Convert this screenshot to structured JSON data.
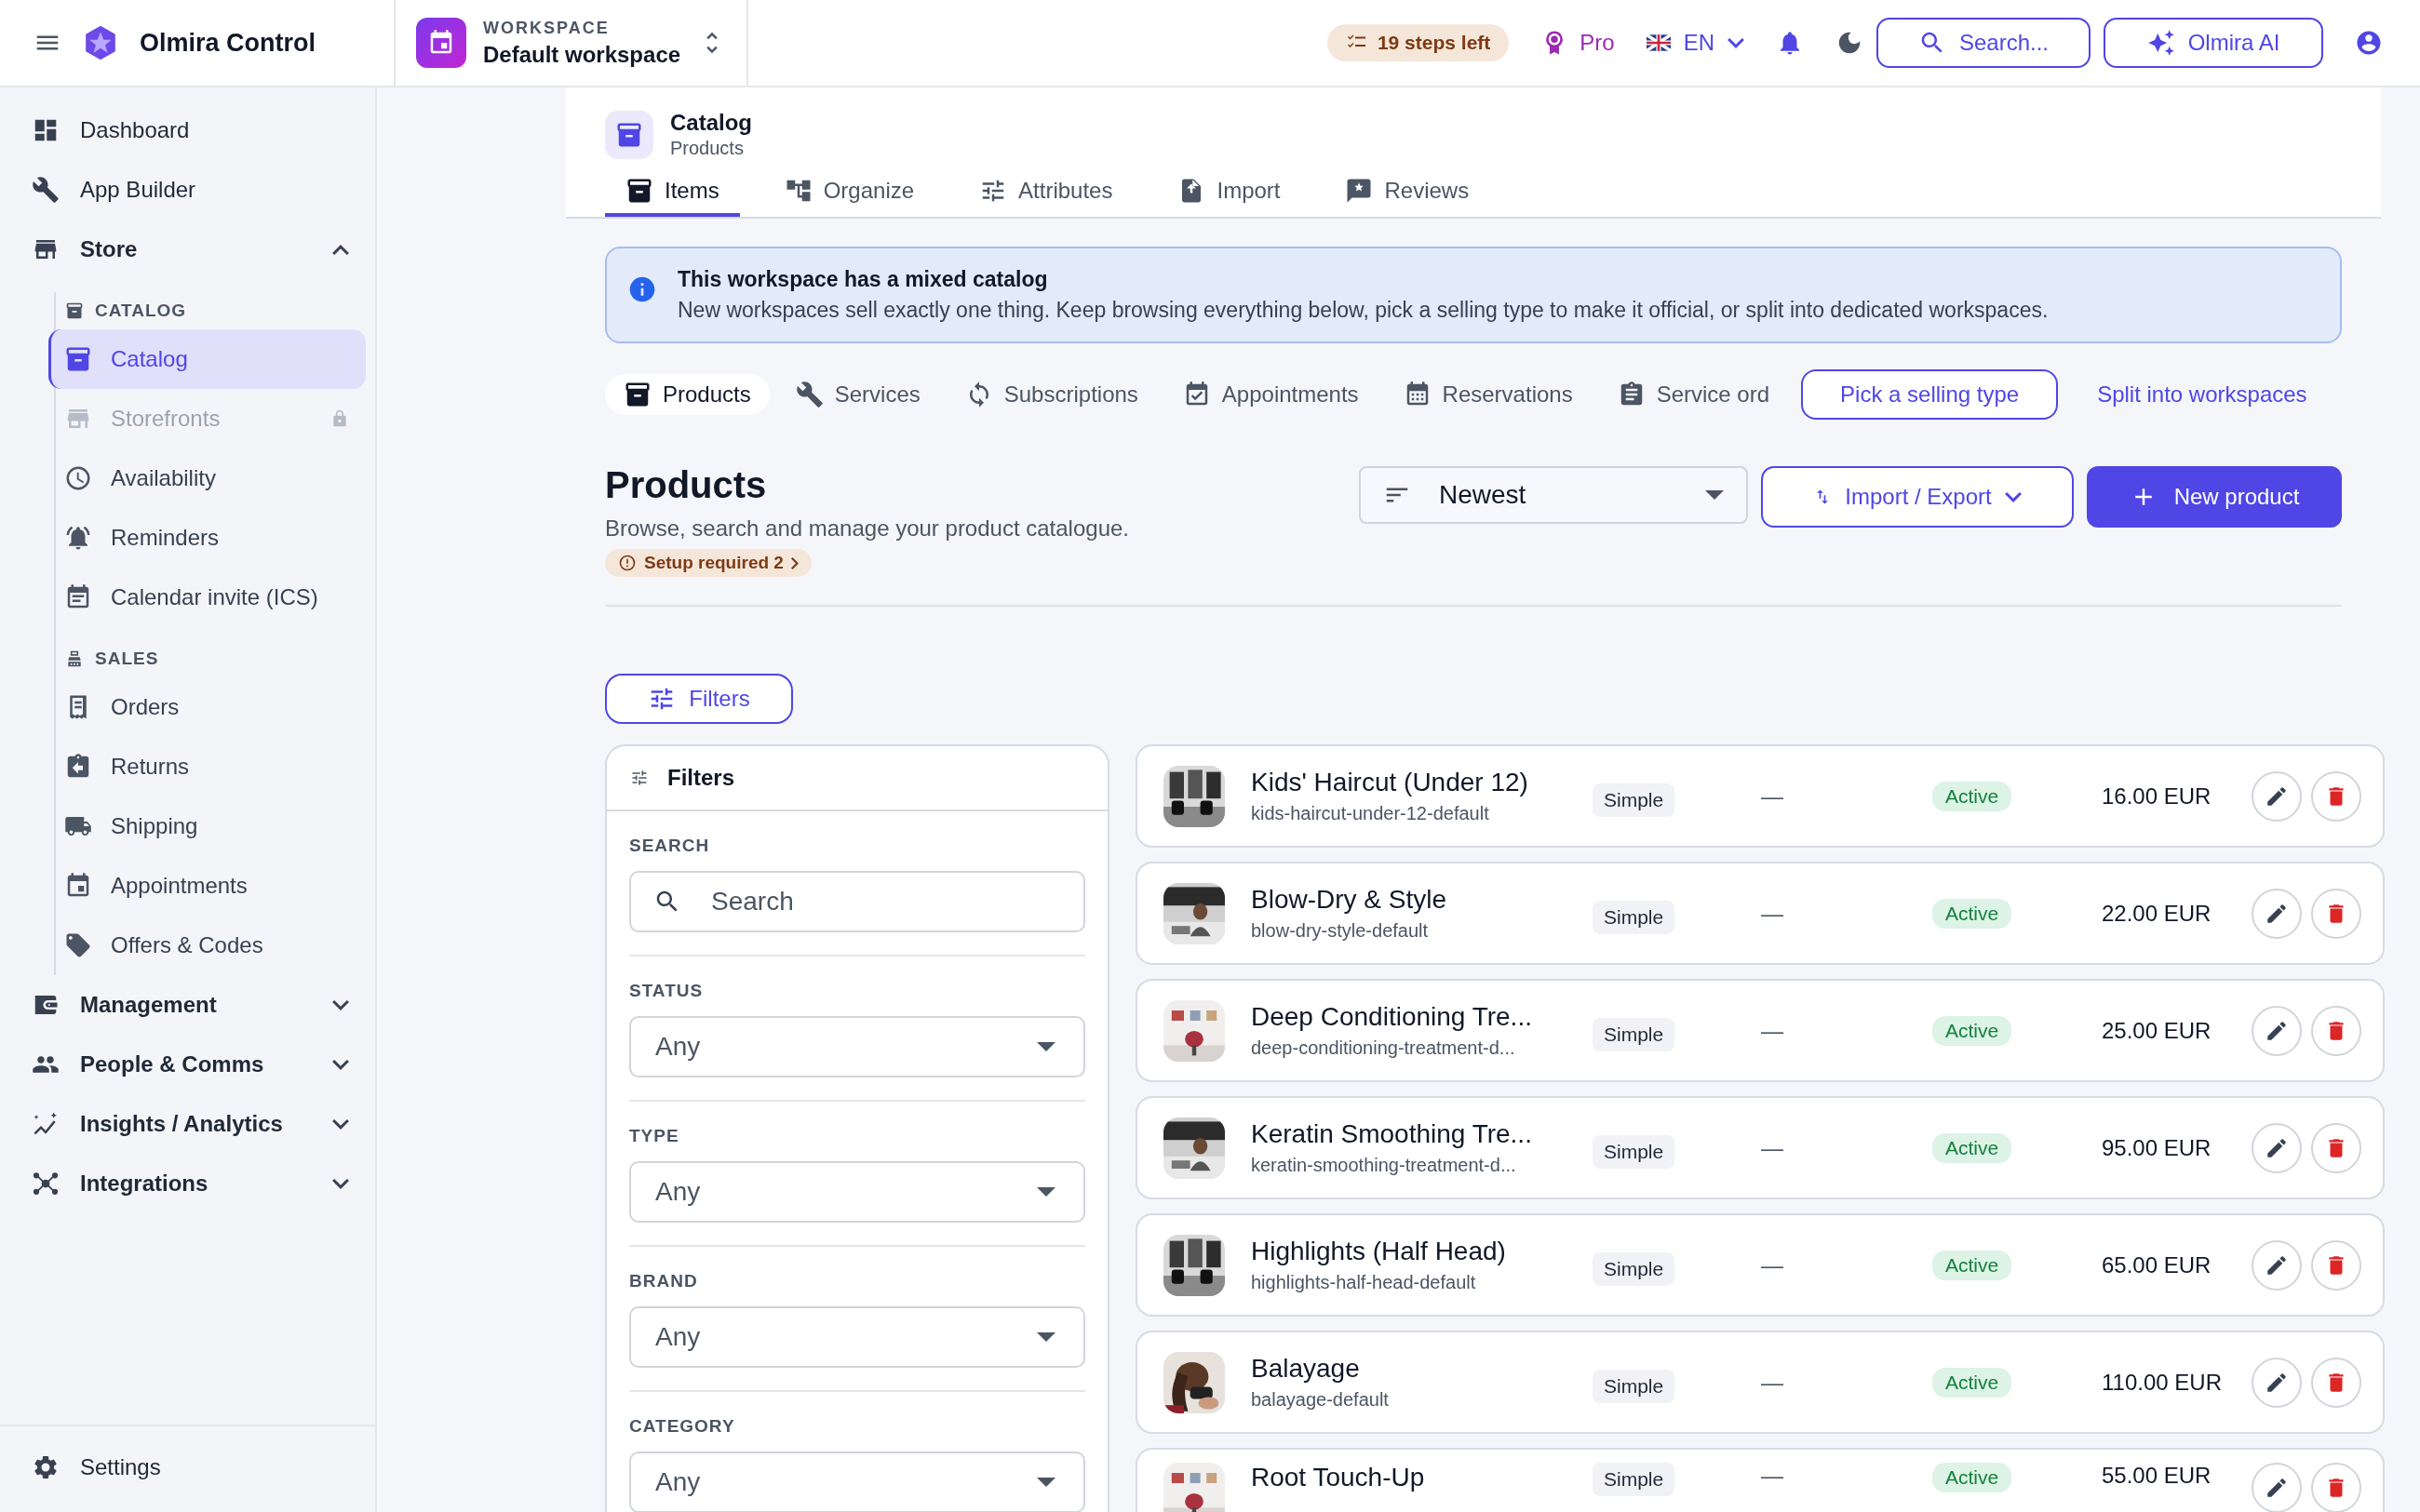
{
  "topbar": {
    "app_name": "Olmira Control",
    "workspace_label": "WORKSPACE",
    "workspace_name": "Default workspace",
    "steps": "19 steps left",
    "plan": "Pro",
    "language": "EN",
    "search": "Search...",
    "ai_button": "Olmira AI"
  },
  "sidebar": {
    "items": [
      {
        "kind": "link",
        "label": "Dashboard",
        "selected": false
      },
      {
        "kind": "link",
        "label": "App Builder",
        "selected": false
      },
      {
        "kind": "section",
        "label": "Store",
        "expanded": true,
        "children": [
          {
            "kind": "group",
            "label": "CATALOG",
            "children": [
              {
                "label": "Catalog",
                "selected": true,
                "disabled": false,
                "locked": false
              },
              {
                "label": "Storefronts",
                "selected": false,
                "disabled": true,
                "locked": true
              },
              {
                "label": "Availability",
                "selected": false,
                "disabled": false,
                "locked": false
              },
              {
                "label": "Reminders",
                "selected": false,
                "disabled": false,
                "locked": false
              },
              {
                "label": "Calendar invite (ICS)",
                "selected": false,
                "disabled": false,
                "locked": false
              }
            ]
          },
          {
            "kind": "group",
            "label": "SALES",
            "children": [
              {
                "label": "Orders",
                "selected": false,
                "disabled": false,
                "locked": false
              },
              {
                "label": "Returns",
                "selected": false,
                "disabled": false,
                "locked": false
              },
              {
                "label": "Shipping",
                "selected": false,
                "disabled": false,
                "locked": false
              },
              {
                "label": "Appointments",
                "selected": false,
                "disabled": false,
                "locked": false
              },
              {
                "label": "Offers & Codes",
                "selected": false,
                "disabled": false,
                "locked": false
              }
            ]
          }
        ]
      },
      {
        "kind": "section",
        "label": "Management",
        "expanded": false
      },
      {
        "kind": "section",
        "label": "People & Comms",
        "expanded": false
      },
      {
        "kind": "section",
        "label": "Insights / Analytics",
        "expanded": false
      },
      {
        "kind": "section",
        "label": "Integrations",
        "expanded": false
      }
    ],
    "footer": "Settings"
  },
  "page_header": {
    "title": "Catalog",
    "subtitle": "Products",
    "tabs": [
      {
        "label": "Items",
        "selected": true
      },
      {
        "label": "Organize",
        "selected": false
      },
      {
        "label": "Attributes",
        "selected": false
      },
      {
        "label": "Import",
        "selected": false
      },
      {
        "label": "Reviews",
        "selected": false
      }
    ]
  },
  "banner": {
    "title": "This workspace has a mixed catalog",
    "text": "New workspaces sell exactly one thing. Keep browsing everything below, pick a selling type to make it official, or split into dedicated workspaces."
  },
  "type_tabs": [
    {
      "label": "Products",
      "selected": true
    },
    {
      "label": "Services",
      "selected": false
    },
    {
      "label": "Subscriptions",
      "selected": false
    },
    {
      "label": "Appointments",
      "selected": false
    },
    {
      "label": "Reservations",
      "selected": false
    },
    {
      "label": "Service ord",
      "selected": false
    }
  ],
  "type_actions": {
    "pick": "Pick a selling type",
    "split": "Split into workspaces"
  },
  "products_header": {
    "title": "Products",
    "description": "Browse, search and manage your product catalogue.",
    "setup_badge": "Setup required 2",
    "sort": "Newest",
    "import_export": "Import / Export",
    "new_product": "New product"
  },
  "filters_button": "Filters",
  "filters": {
    "title": "Filters",
    "fields": [
      {
        "kind": "search",
        "label": "SEARCH",
        "placeholder": "Search"
      },
      {
        "kind": "select",
        "label": "STATUS",
        "value": "Any"
      },
      {
        "kind": "select",
        "label": "TYPE",
        "value": "Any"
      },
      {
        "kind": "select",
        "label": "BRAND",
        "value": "Any"
      },
      {
        "kind": "select",
        "label": "CATEGORY",
        "value": "Any"
      }
    ]
  },
  "products": [
    {
      "name": "Kids' Haircut (Under 12)",
      "slug": "kids-haircut-under-12-default",
      "type": "Simple",
      "column_3": "—",
      "status": "Active",
      "price": "16.00 EUR"
    },
    {
      "name": "Blow-Dry & Style",
      "slug": "blow-dry-style-default",
      "type": "Simple",
      "column_3": "—",
      "status": "Active",
      "price": "22.00 EUR"
    },
    {
      "name": "Deep Conditioning Tre...",
      "slug": "deep-conditioning-treatment-d...",
      "type": "Simple",
      "column_3": "—",
      "status": "Active",
      "price": "25.00 EUR"
    },
    {
      "name": "Keratin Smoothing Tre...",
      "slug": "keratin-smoothing-treatment-d...",
      "type": "Simple",
      "column_3": "—",
      "status": "Active",
      "price": "95.00 EUR"
    },
    {
      "name": "Highlights (Half Head)",
      "slug": "highlights-half-head-default",
      "type": "Simple",
      "column_3": "—",
      "status": "Active",
      "price": "65.00 EUR"
    },
    {
      "name": "Balayage",
      "slug": "balayage-default",
      "type": "Simple",
      "column_3": "—",
      "status": "Active",
      "price": "110.00 EUR"
    },
    {
      "name": "Root Touch-Up",
      "type": "Simple",
      "column_3": "—",
      "status": "Active",
      "price": "55.00 EUR"
    }
  ]
}
